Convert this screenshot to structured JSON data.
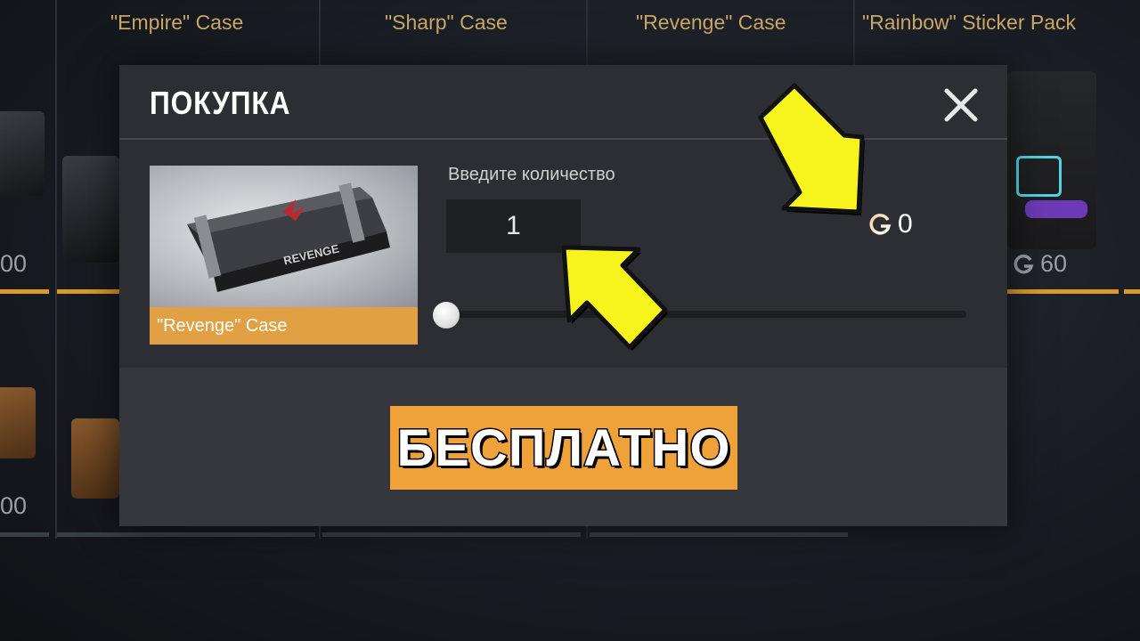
{
  "shop": {
    "columns": [
      {
        "title": "\"Empire\" Case"
      },
      {
        "title": "\"Sharp\" Case"
      },
      {
        "title": "\"Revenge\" Case"
      },
      {
        "title": "\"Rainbow\" Sticker Pack"
      }
    ],
    "left_prices": [
      "00",
      "00"
    ],
    "rainbow_price": "60"
  },
  "modal": {
    "title": "ПОКУПКА",
    "item_name": "\"Revenge\" Case",
    "item_art_text": "REVENGE",
    "quantity_label": "Введите количество",
    "quantity_value": "1",
    "price_value": "0",
    "buy_button_label": "БЕСПЛАТНО"
  },
  "icons": [
    "close-icon",
    "gold-coin-icon"
  ],
  "colors": {
    "accent_orange": "#efa23a",
    "item_label_orange": "#e0a043",
    "annotation_arrow": "#f7f31c",
    "modal_bg": "#2c2e33"
  }
}
